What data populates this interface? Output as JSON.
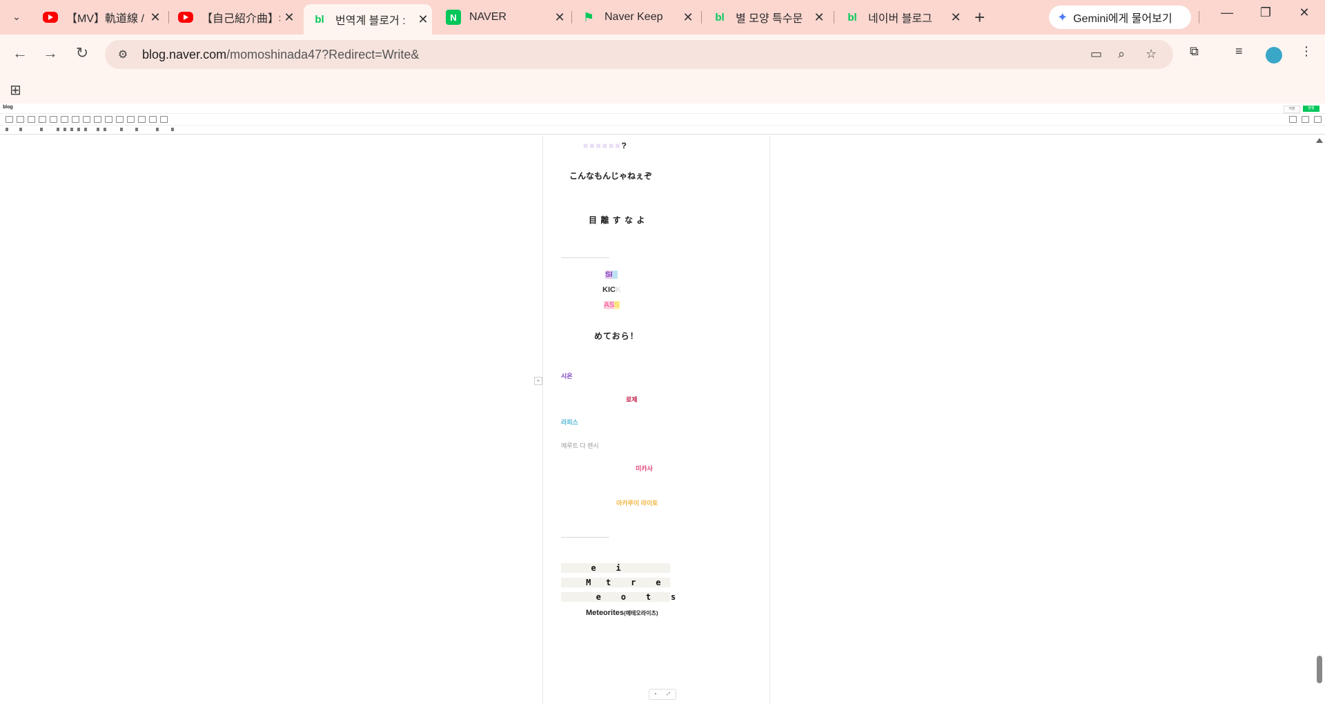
{
  "browser": {
    "tabs": [
      {
        "title": "【MV】軌道線 / 日",
        "favicon": "youtube-icon",
        "active": false
      },
      {
        "title": "【自己紹介曲】SI",
        "favicon": "youtube-icon",
        "active": false
      },
      {
        "title": "번역계 블로거 :",
        "favicon": "blog-icon",
        "active": true
      },
      {
        "title": "NAVER",
        "favicon": "naver-icon",
        "active": false
      },
      {
        "title": "Naver Keep",
        "favicon": "bookmark-icon",
        "active": false
      },
      {
        "title": "별 모양 특수문",
        "favicon": "blog-icon",
        "active": false
      },
      {
        "title": "네이버 블로그",
        "favicon": "blog-icon",
        "active": false
      }
    ],
    "gemini_label": "Gemini에게 물어보기",
    "url_host": "blog.naver.com",
    "url_path": "/momoshinada47?Redirect=Write&"
  },
  "editor": {
    "logo": "blog",
    "publish_label": "발행",
    "save_label": "저장"
  },
  "document": {
    "line_partial": "?",
    "line_ja1": "こんなもんじゃねぇぞ",
    "line_ja2": "目 離 す な よ",
    "six_1": "SI",
    "six_2": "KIC",
    "six_3": "AS",
    "line_ja3": "めておら！",
    "names": [
      {
        "text": "시온",
        "color": "#7a3fc4"
      },
      {
        "text": "로제",
        "color": "#c21f4a"
      },
      {
        "text": "라피스",
        "color": "#4fb8d8"
      },
      {
        "text": "메루트 다 랜시",
        "color": "#9a9a9a"
      },
      {
        "text": "미카사",
        "color": "#e0407a"
      },
      {
        "text": "아카루이 라이토",
        "color": "#f0b43c"
      }
    ],
    "grid_rows": [
      "      e    i",
      "     M   t    r    e",
      "       e    o    t    s"
    ],
    "meteorites": "Meteorites",
    "meteorites_reading": "(메테오라이츠)"
  },
  "colors": {
    "tabstrip": "#fbd7d0",
    "toolbar": "#fff5f0",
    "omnibox": "#f6e3de",
    "naver_green": "#03c75a"
  }
}
